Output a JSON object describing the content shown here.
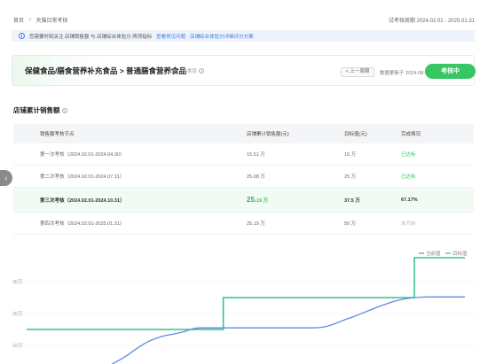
{
  "breadcrumb": {
    "home": "首页",
    "separator": ">",
    "current": "天猫日常考核"
  },
  "period": {
    "label": "试考核周期",
    "range": "2024.02.01 - 2025.01.31"
  },
  "notice": {
    "text": "您需要时刻关注 店铺销售额 与 店铺综合体验分 两项指标",
    "link1": "查看常见问题",
    "link2": "店铺综合体验分详细评分方案"
  },
  "hero": {
    "title": "保健食品/膳食营养补充食品 > 普通膳食营养食品",
    "subtitle": "考核三类类目",
    "prev_button": "< 上一周期",
    "updated_label": "数据更新于",
    "updated_date": "2024-08-25",
    "status": "考核中"
  },
  "section_title": "店铺累计销售额",
  "table": {
    "headers": [
      "销售额考核节点",
      "店铺累计销售额(元)",
      "目标值(元)",
      "完成情况"
    ],
    "rows": [
      {
        "node": "第一次考核（2024.02.01-2024.04.30）",
        "sales": "15.51 万",
        "target": "15 万",
        "status": "已达标",
        "state": "done"
      },
      {
        "node": "第二次考核（2024.02.01-2024.07.31）",
        "sales": "25.08 万",
        "target": "25 万",
        "status": "已达标",
        "state": "done"
      },
      {
        "node": "第三次考核（2024.02.01-2024.10.31）",
        "sales_big": "25.",
        "sales_small": "19 万",
        "target": "37.5 万",
        "status": "67.17%",
        "state": "current"
      },
      {
        "node": "第四次考核（2024.02.01-2025.01.31）",
        "sales": "25.19 万",
        "target": "50 万",
        "status": "未开启",
        "state": "pending"
      }
    ]
  },
  "chart_data": {
    "type": "line",
    "legend": {
      "placement": "top-right"
    },
    "yticks": [
      "10万",
      "20万",
      "30万"
    ],
    "y_tick_values": [
      10,
      20,
      30
    ],
    "series": [
      {
        "name": "当前值",
        "color": "#5b8ee0",
        "values": [
          0,
          0,
          0,
          0,
          0,
          0,
          0,
          0,
          0,
          0,
          0.3,
          0.9,
          1.5,
          2.2,
          3.0,
          3.9,
          4.9,
          5.9,
          7.0,
          8.3,
          9.5,
          10.6,
          11.5,
          12.2,
          12.8,
          13.2,
          13.5,
          13.9,
          14.3,
          14.9,
          15.4,
          15.5,
          15.5,
          15.5,
          15.5,
          15.5,
          15.5,
          15.5,
          15.5,
          15.5,
          15.5,
          15.5,
          15.5,
          15.5,
          15.5,
          15.5,
          15.5,
          15.5,
          15.5,
          15.5,
          15.5,
          15.5,
          15.6,
          15.8,
          16.3,
          16.9,
          17.6,
          18.3,
          18.9,
          19.6,
          20.3,
          21.0,
          21.7,
          22.4,
          23.0,
          23.6,
          24.1,
          24.5,
          24.8,
          25.0,
          25.1,
          25.19,
          25.19,
          25.19,
          25.19,
          25.19,
          25.19,
          25.19,
          25.19
        ]
      },
      {
        "name": "目标值",
        "color": "#36c48b",
        "values": [
          15,
          15,
          15,
          15,
          15,
          15,
          15,
          15,
          15,
          15,
          15,
          15,
          15,
          15,
          15,
          15,
          15,
          15,
          15,
          15,
          15,
          15,
          15,
          15,
          15,
          15,
          15,
          15,
          15,
          15,
          15,
          15,
          15,
          15,
          15,
          25,
          25,
          25,
          25,
          25,
          25,
          25,
          25,
          25,
          25,
          25,
          25,
          25,
          25,
          25,
          25,
          25,
          25,
          25,
          25,
          25,
          25,
          25,
          25,
          25,
          25,
          25,
          25,
          25,
          25,
          25,
          25,
          25,
          25,
          37.5,
          37.5,
          37.5,
          37.5,
          37.5,
          37.5,
          37.5,
          37.5,
          37.5,
          37.5
        ]
      }
    ]
  },
  "icons": {
    "info": "info-icon",
    "help": "question-icon",
    "side": "arrow-left-icon"
  }
}
